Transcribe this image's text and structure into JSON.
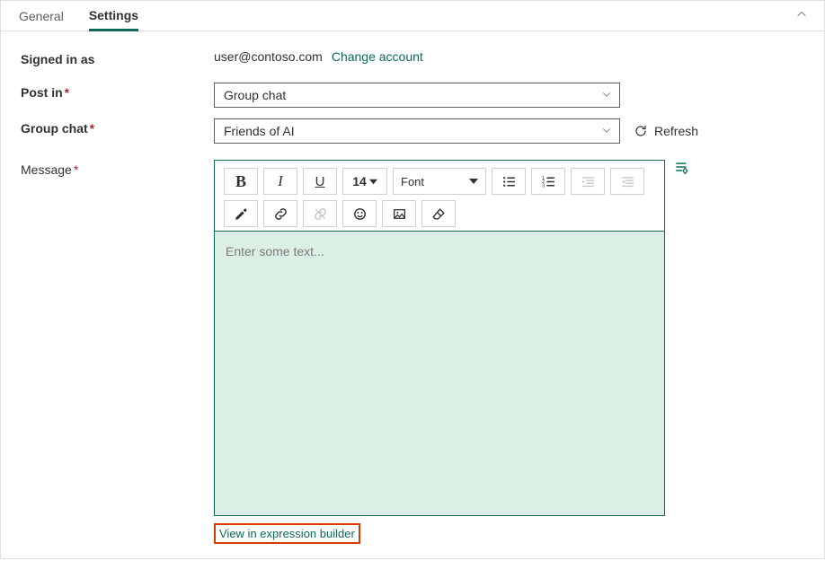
{
  "tabs": {
    "general": "General",
    "settings": "Settings"
  },
  "labels": {
    "signed_in": "Signed in as",
    "post_in": "Post in",
    "group_chat": "Group chat",
    "message": "Message"
  },
  "signed_in": {
    "email": "user@contoso.com",
    "change": "Change account"
  },
  "post_in": {
    "value": "Group chat"
  },
  "group_chat": {
    "value": "Friends of AI",
    "refresh": "Refresh"
  },
  "editor": {
    "font_size": "14",
    "font_label": "Font",
    "placeholder": "Enter some text..."
  },
  "footer": {
    "expression_builder": "View in expression builder"
  }
}
